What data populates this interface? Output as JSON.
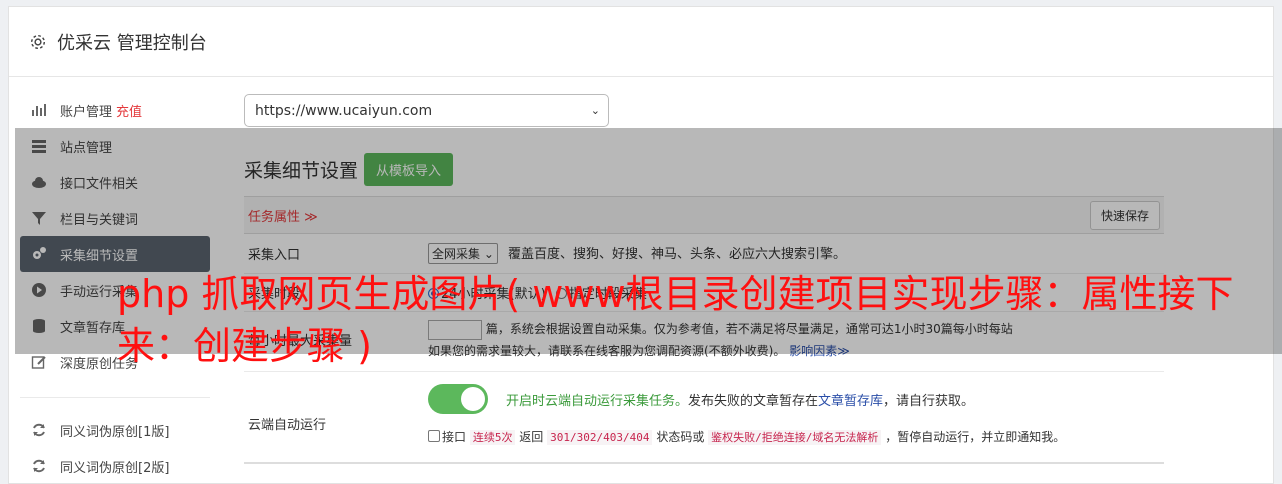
{
  "header": {
    "title": "优采云 管理控制台"
  },
  "sidebar": {
    "items": [
      {
        "label": "账户管理",
        "badge": "充值"
      },
      {
        "label": "站点管理"
      },
      {
        "label": "接口文件相关"
      },
      {
        "label": "栏目与关键词"
      },
      {
        "label": "采集细节设置"
      },
      {
        "label": "手动运行采集"
      },
      {
        "label": "文章暂存库"
      },
      {
        "label": "深度原创任务"
      }
    ],
    "items2": [
      {
        "label": "同义词伪原创[1版]"
      },
      {
        "label": "同义词伪原创[2版]"
      }
    ]
  },
  "site_select": {
    "value": "https://www.ucaiyun.com"
  },
  "section": {
    "title": "采集细节设置",
    "import_button": "从模板导入"
  },
  "task_bar": {
    "label": "任务属性 ≫",
    "save_button": "快速保存"
  },
  "rows": {
    "entry": {
      "label": "采集入口",
      "select": "全网采集",
      "desc": "覆盖百度、搜狗、好搜、神马、头条、必应六大搜索引擎。"
    },
    "time": {
      "label": "采集时段",
      "opt1": "24小时采集(默认)",
      "opt2": "指定时段采集"
    },
    "max": {
      "label": "每小时最大采集量",
      "desc1": "篇，系统会根据设置自动采集。仅为参考值，若不满足将尽量满足，通常可达1小时30篇每小时每站",
      "desc2": "如果您的需求量较大，请联系在线客服为您调配资源(不额外收费)。",
      "link": "影响因素≫"
    },
    "cloud": {
      "label": "云端自动运行",
      "status": "开启时云端自动运行采集任务。",
      "text1": "发布失败的文章暂存在",
      "link": "文章暂存库",
      "text2": "，请自行获取。",
      "chk_label": "接口",
      "code1": "连续5次",
      "t3": "返回",
      "code2": "301/302/403/404",
      "t4": "状态码或",
      "code3": "鉴权失败/拒绝连接/域名无法解析",
      "t5": "，暂停自动运行，并立即通知我。"
    }
  },
  "watermark": {
    "text": "php 抓取网页生成图片( www根目录创建项目实现步骤：属性接下来：创建步骤 )"
  },
  "colors": {
    "accent": "#5cb85c",
    "danger": "#e4393c",
    "active": "#5b6470"
  }
}
